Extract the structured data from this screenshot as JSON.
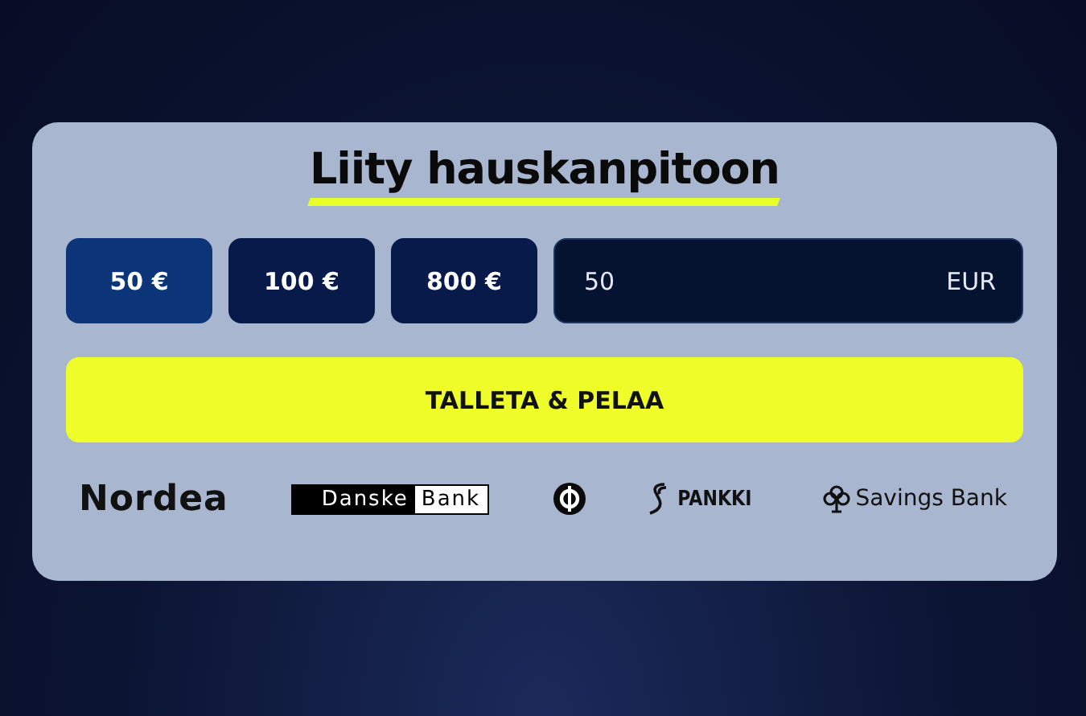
{
  "title": "Liity hauskanpitoon",
  "amounts": [
    {
      "label": "50 €",
      "selected": true
    },
    {
      "label": "100 €",
      "selected": false
    },
    {
      "label": "800 €",
      "selected": false
    }
  ],
  "amount_field": {
    "value": "50",
    "currency": "EUR"
  },
  "submit_button": "TALLETA & PELAA",
  "banks": [
    {
      "kind": "wordmark",
      "text": "Nordea"
    },
    {
      "kind": "split",
      "text": "Danske",
      "text_2": "Bank"
    },
    {
      "kind": "emblem"
    },
    {
      "kind": "s-mark",
      "text": "PANKKI"
    },
    {
      "kind": "clover",
      "text": "Savings Bank"
    }
  ]
}
